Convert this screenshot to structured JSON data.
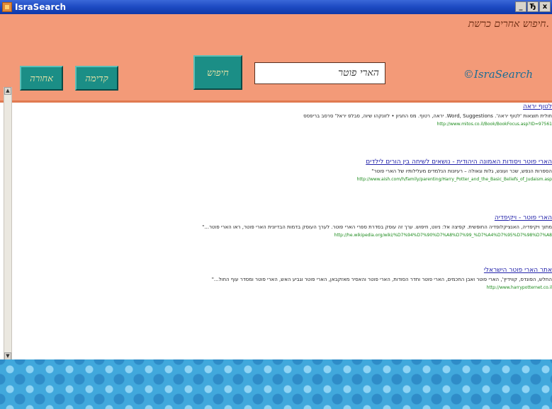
{
  "window": {
    "title": "IsraSearch",
    "controls": {
      "minimize": "_",
      "maximize": "Ђ",
      "close": "x"
    }
  },
  "header": {
    "top_link": "חיפוש אחרים כרשת.",
    "back_label": "אחורה",
    "skip_label": "קדימה",
    "search_label": "חיפוש",
    "search_value": "הארי פוטר",
    "logo": "©IsraSearch"
  },
  "scrollbar": {
    "up": "▲",
    "down": "▼"
  },
  "results": [
    {
      "title": "לטוף יראה",
      "desc": "חולית תוצאות 'לטוף יראה'. Word, Suggestions. יראה, רטוף. מס החגיון • לזונקהו שיוה, סבלפ יראל' סרסב בריפסס",
      "url": "http://www.mitos.co.il/Book/BookFocus.asp?ID=97561"
    },
    {
      "title": "הארי פוטר ויסודות האמונה היהודית - נושאים לשיחה בין הורים לילדים",
      "desc": "הספרות הנפש, שכר ועונש, גלות וגאולה – רעיונות הנלמדים מעלילותיו של הארי פוטר\"",
      "url": "http://www.aish.com/h/family/parenting/Harry_Potter_and_the_Basic_Beliefs_of_Judaism.asp"
    },
    {
      "title": "הארי פוטר - ויקיפדיה",
      "desc": "מתוך ויקיפדיה, האנציקלופדיה החופשית. קפיצה אל: ניווט, חיפוש. ערך זה עוסק בסדרת ספרי הארי פוטר. לערך העוסק בדמות הבדיונית הארי פוטר, ראו הארי פוטר...\"",
      "url": "http://he.wikipedia.org/wiki/%D7%94%D7%90%D7%A8%D7%99_%D7%A4%D7%95%D7%98%D7%A8"
    },
    {
      "title": "אתר הארי פוטר הישראלי",
      "desc": "החלש, הפונדס, קווידיץ', הארי פוטר ואבן החכמים, הארי פוטר וחדר הסודות, הארי פוטר והאסיר מאזקבאן, הארי פוטר וגביע האש, הארי פוטר ומסדר עוף החול...\"",
      "url": "http://www.harrypotternet.co.il"
    }
  ]
}
